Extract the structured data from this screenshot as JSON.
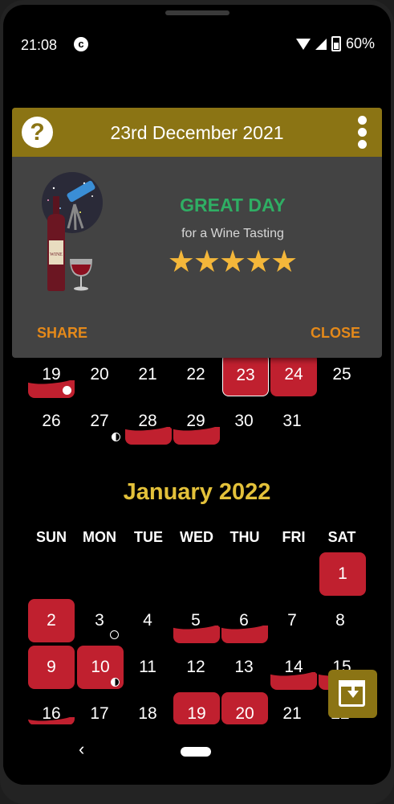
{
  "status_bar": {
    "time": "21:08",
    "battery": "60%"
  },
  "dialog": {
    "title": "23rd December 2021",
    "rating_title": "GREAT DAY",
    "rating_subtitle": "for a Wine Tasting",
    "stars": 5,
    "share_label": "SHARE",
    "close_label": "CLOSE",
    "illustration": "wine-telescope-illustration"
  },
  "december_partial": {
    "week1": [
      "19",
      "20",
      "21",
      "22",
      "23",
      "24",
      "25"
    ],
    "week2": [
      "26",
      "27",
      "28",
      "29",
      "30",
      "31"
    ]
  },
  "january": {
    "title": "January 2022",
    "weekdays": [
      "SUN",
      "MON",
      "TUE",
      "WED",
      "THU",
      "FRI",
      "SAT"
    ],
    "row1": [
      "1"
    ],
    "row2": [
      "2",
      "3",
      "4",
      "5",
      "6",
      "7",
      "8"
    ],
    "row3": [
      "9",
      "10",
      "11",
      "12",
      "13",
      "14",
      "15"
    ],
    "row4": [
      "16",
      "17",
      "18",
      "19",
      "20",
      "21",
      "22"
    ]
  },
  "colors": {
    "accent_gold": "#8b7414",
    "good_day_red": "#c0202f",
    "title_gold": "#e3c13a",
    "great_green": "#2fae64",
    "button_orange": "#e4891a"
  },
  "icons": {
    "help": "help-icon",
    "menu": "more-vert-icon",
    "fab": "calendar-download-icon"
  }
}
